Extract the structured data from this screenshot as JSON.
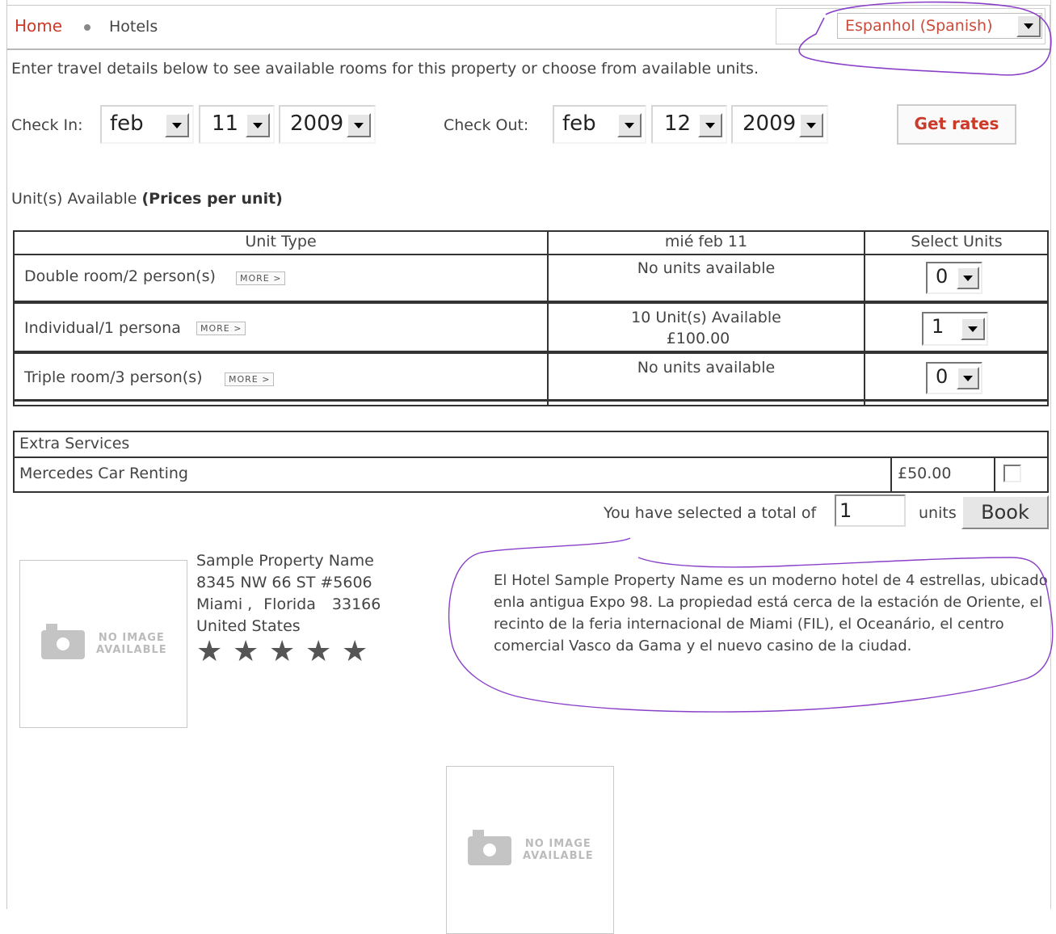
{
  "breadcrumb": {
    "home": "Home",
    "current": "Hotels"
  },
  "language": {
    "selected": "Espanhol (Spanish)"
  },
  "intro": "Enter travel details below to see available rooms for this property or choose from available units.",
  "dates": {
    "check_in_label": "Check In:",
    "check_in": {
      "month": "feb",
      "day": "11",
      "year": "2009"
    },
    "check_out_label": "Check Out:",
    "check_out": {
      "month": "feb",
      "day": "12",
      "year": "2009"
    },
    "get_rates": "Get rates"
  },
  "units_section": {
    "title": "Unit(s) Available ",
    "title_bold": "(Prices per unit)"
  },
  "units_table": {
    "headers": [
      "Unit Type",
      "mié feb 11",
      "Select Units"
    ],
    "more_label": "MORE >",
    "rows": [
      {
        "type": "Double room/2 person(s)",
        "availability": "No units available",
        "price": "",
        "selected": "0"
      },
      {
        "type": "Individual/1 persona",
        "availability": "10   Unit(s) Available",
        "price": "£100.00",
        "selected": "1"
      },
      {
        "type": "Triple room/3 person(s)",
        "availability": "No units available",
        "price": "",
        "selected": "0"
      }
    ]
  },
  "extras": {
    "title": "Extra Services",
    "items": [
      {
        "name": "Mercedes Car Renting",
        "price": "£50.00",
        "checked": false
      }
    ]
  },
  "total": {
    "label": "You have selected a total of",
    "value": "1",
    "units": "units",
    "book": "Book"
  },
  "property": {
    "name": "Sample Property Name",
    "address1": "8345 NW 66 ST #5606",
    "city": "Miami ,",
    "state": "Florida",
    "zip": "33166",
    "country": "United States",
    "stars": 5,
    "no_image_text_1": "NO IMAGE",
    "no_image_text_2": "AVAILABLE",
    "description": "El Hotel Sample Property Name es un moderno hotel de 4 estrellas, ubicado enla antigua Expo 98. La propiedad está cerca de la estación de Oriente, el recinto de la feria internacional de Miami (FIL), el Oceanário, el centro comercial Vasco da Gama y el nuevo casino de la ciudad."
  },
  "colors": {
    "accent": "#cc3a2a",
    "annotation": "#8a3fc8"
  }
}
